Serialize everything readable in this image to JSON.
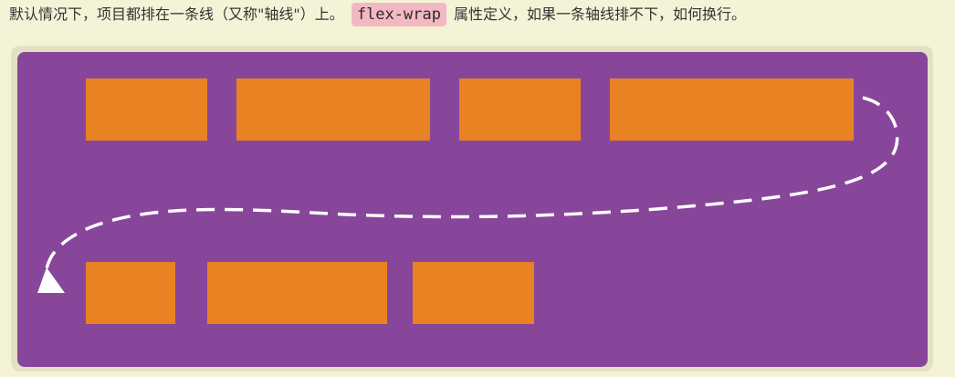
{
  "intro": {
    "before": "默认情况下，项目都排在一条线（又称\"轴线\"）上。",
    "code": "flex-wrap",
    "after": "属性定义，如果一条轴线排不下，如何换行。"
  },
  "colors": {
    "page_background": "#f5f3d7",
    "container": "#88469a",
    "item": "#e88223",
    "code_background": "#f4b8c2",
    "arrow": "#ffffff"
  },
  "diagram": {
    "row1_item_count": 4,
    "row2_item_count": 3
  }
}
